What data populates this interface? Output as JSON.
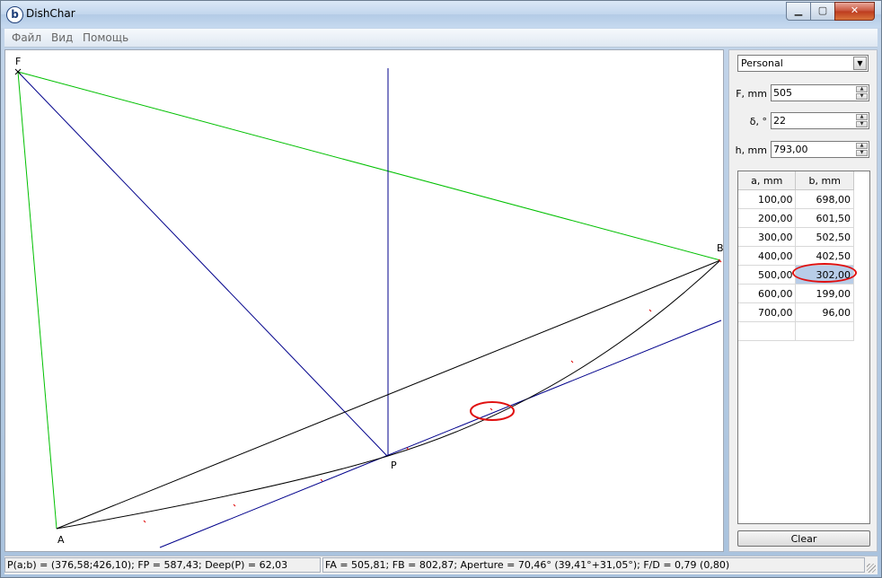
{
  "window": {
    "title": "DishChar",
    "icon": "b",
    "controls": {
      "minimize": "▁",
      "maximize": "▢",
      "close": "✕"
    }
  },
  "menu": [
    "Файл",
    "Вид",
    "Помощь"
  ],
  "diagram": {
    "points": [
      {
        "name": "F"
      },
      {
        "name": "B"
      },
      {
        "name": "P"
      },
      {
        "name": "A"
      }
    ],
    "colors": {
      "green": "#00c000",
      "blue": "#00008b",
      "black": "#000000",
      "red": "#e00000"
    }
  },
  "panel": {
    "profile": "Personal",
    "fields": [
      {
        "label": "F, mm",
        "value": "505"
      },
      {
        "label": "δ, °",
        "value": "22"
      },
      {
        "label": "h, mm",
        "value": "793,00"
      }
    ],
    "table": {
      "columns": [
        "a, mm",
        "b, mm"
      ],
      "rows": [
        [
          "100,00",
          "698,00"
        ],
        [
          "200,00",
          "601,50"
        ],
        [
          "300,00",
          "502,50"
        ],
        [
          "400,00",
          "402,50"
        ],
        [
          "500,00",
          "302,00"
        ],
        [
          "600,00",
          "199,00"
        ],
        [
          "700,00",
          "96,00"
        ],
        [
          "",
          ""
        ]
      ],
      "selected_row": 4
    },
    "clear_label": "Clear"
  },
  "status": {
    "left": "P(a;b) = (376,58;426,10); FP = 587,43; Deep(P) = 62,03",
    "right": "FA = 505,81; FB = 802,87; Aperture = 70,46° (39,41°+31,05°); F/D = 0,79 (0,80)"
  }
}
